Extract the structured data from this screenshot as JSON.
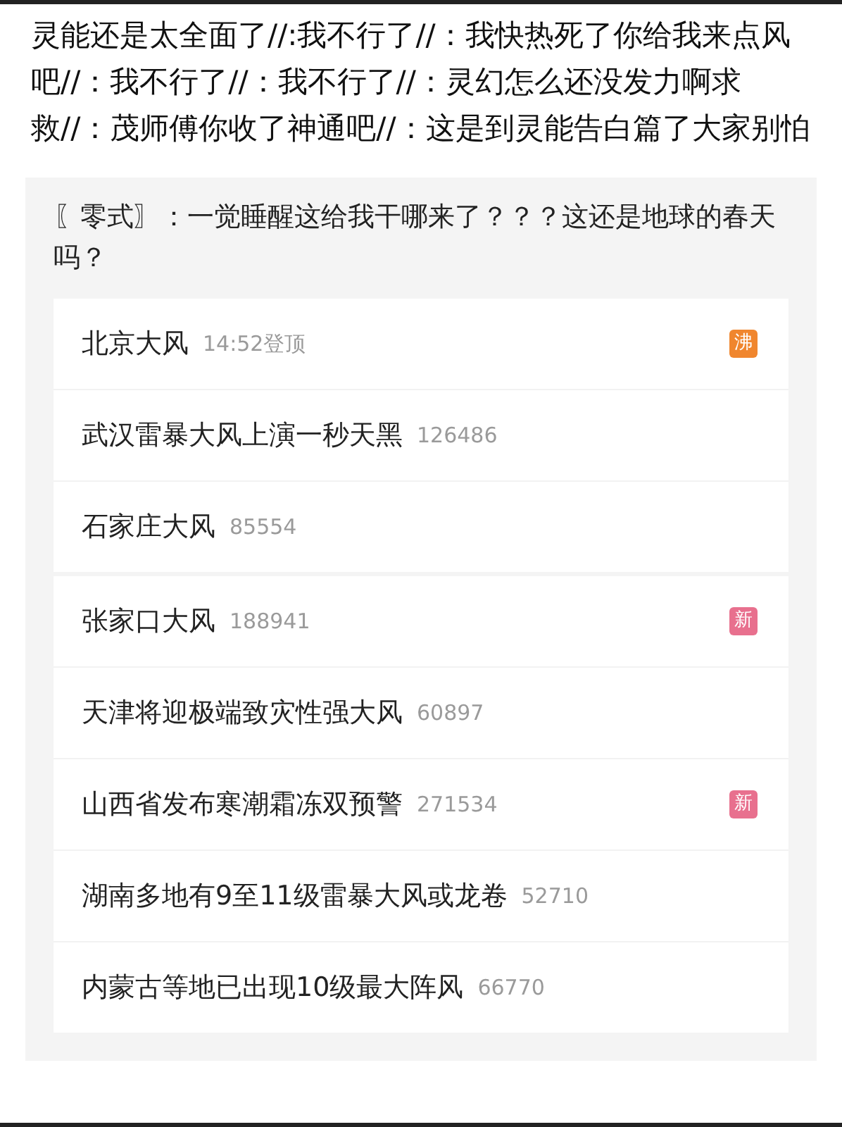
{
  "post": {
    "text": "灵能还是太全面了//:我不行了//：我快热死了你给我来点风吧//：我不行了//：我不行了//：灵幻怎么还没发力啊求救//：茂师傅你收了神通吧//：这是到灵能告白篇了大家别怕"
  },
  "quote": {
    "text": "〖零式〗：一觉睡醒这给我干哪来了？？？这还是地球的春天吗？",
    "groups": [
      [
        {
          "title": "北京大风",
          "meta": "14:52登顶",
          "badge": {
            "kind": "hot",
            "label": "沸"
          }
        },
        {
          "title": "武汉雷暴大风上演一秒天黑",
          "meta": "126486"
        },
        {
          "title": "石家庄大风",
          "meta": "85554"
        }
      ],
      [
        {
          "title": "张家口大风",
          "meta": "188941",
          "badge": {
            "kind": "new",
            "label": "新"
          }
        },
        {
          "title": "天津将迎极端致灾性强大风",
          "meta": "60897"
        },
        {
          "title": "山西省发布寒潮霜冻双预警",
          "meta": "271534",
          "badge": {
            "kind": "new",
            "label": "新"
          }
        },
        {
          "title": "湖南多地有9至11级雷暴大风或龙卷",
          "meta": "52710"
        },
        {
          "title": "内蒙古等地已出现10级最大阵风",
          "meta": "66770"
        }
      ]
    ]
  }
}
